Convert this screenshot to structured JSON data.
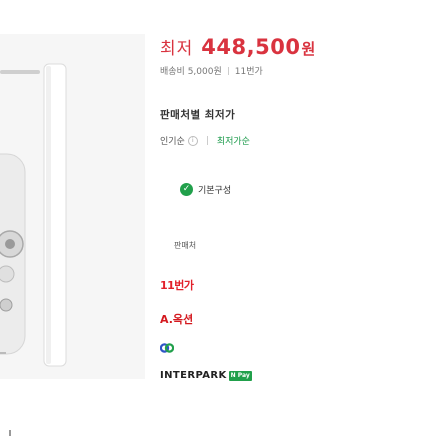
{
  "price": {
    "label": "최저",
    "value": "448,500",
    "unit": "원"
  },
  "shipping": {
    "fee": "배송비 5,000원",
    "count": "11번가"
  },
  "sellers_section": {
    "title": "판매처별 최저가"
  },
  "sort": {
    "popular": "인기순",
    "info_glyph": "i",
    "lowest": "최저가순"
  },
  "option": {
    "label": "기본구성",
    "check_glyph": "✓"
  },
  "seller_list": {
    "header": "판매처",
    "items": [
      {
        "name": "11번가",
        "logo_text": "11번가"
      },
      {
        "name": "옥션",
        "logo_text": "A.옥션"
      },
      {
        "name": "G마켓",
        "logo_text": "G"
      },
      {
        "name": "인터파크",
        "logo_text": "INTERPARK",
        "badge": "N Pay"
      }
    ]
  },
  "colors": {
    "price": "#d9333f",
    "accent_green": "#21a04b",
    "elevenst_red": "#e2202a",
    "gmarket_blue": "#2f55c6"
  },
  "icons": {
    "check": "check-circle-icon",
    "info": "info-icon"
  }
}
